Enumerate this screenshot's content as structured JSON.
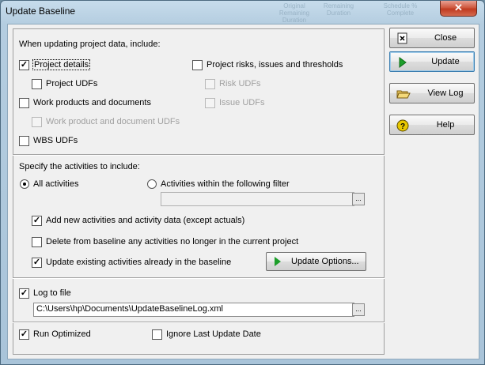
{
  "window": {
    "title": "Update Baseline",
    "close_glyph": "✕",
    "bg_hints": [
      "Original Remaining Duration",
      "Remaining Duration",
      "Schedule % Complete"
    ]
  },
  "include_section": {
    "heading": "When updating project data, include:",
    "options": {
      "project_details": {
        "label": "Project details",
        "checked": true
      },
      "project_udfs": {
        "label": "Project UDFs",
        "checked": false
      },
      "work_products": {
        "label": "Work products and documents",
        "checked": false
      },
      "work_product_udfs": {
        "label": "Work product and document UDFs",
        "checked": false,
        "disabled": true
      },
      "wbs_udfs": {
        "label": "WBS UDFs",
        "checked": false
      },
      "project_risks": {
        "label": "Project risks, issues and thresholds",
        "checked": false
      },
      "risk_udfs": {
        "label": "Risk UDFs",
        "checked": false,
        "disabled": true
      },
      "issue_udfs": {
        "label": "Issue UDFs",
        "checked": false,
        "disabled": true
      }
    }
  },
  "activities_section": {
    "heading": "Specify the activities to include:",
    "radio_all": {
      "label": "All activities",
      "selected": true
    },
    "radio_filter": {
      "label": "Activities within the following filter",
      "selected": false
    },
    "filter_value": "",
    "add_new": {
      "label": "Add new activities and activity data (except actuals)",
      "checked": true
    },
    "delete_from": {
      "label": "Delete from baseline any activities no longer in the current project",
      "checked": false
    },
    "update_existing": {
      "label": "Update existing activities already in the baseline",
      "checked": true
    },
    "update_options_label": "Update Options..."
  },
  "log_section": {
    "log_to_file": {
      "label": "Log to file",
      "checked": true
    },
    "log_path": "C:\\Users\\hp\\Documents\\UpdateBaselineLog.xml"
  },
  "bottom_section": {
    "run_optimized": {
      "label": "Run Optimized",
      "checked": true
    },
    "ignore_last": {
      "label": "Ignore Last Update Date",
      "checked": false
    }
  },
  "buttons": {
    "close": {
      "label": "Close",
      "icon": "close-doc-icon"
    },
    "update": {
      "label": "Update",
      "icon": "play-icon"
    },
    "view_log": {
      "label": "View Log",
      "icon": "folder-open-icon"
    },
    "help": {
      "label": "Help",
      "icon": "help-icon"
    }
  },
  "browse_glyph": "...",
  "check_glyph": "✓",
  "colors": {
    "accent_green": "#1c9e2a",
    "close_red": "#c03a20",
    "help_yellow": "#e8c800"
  }
}
